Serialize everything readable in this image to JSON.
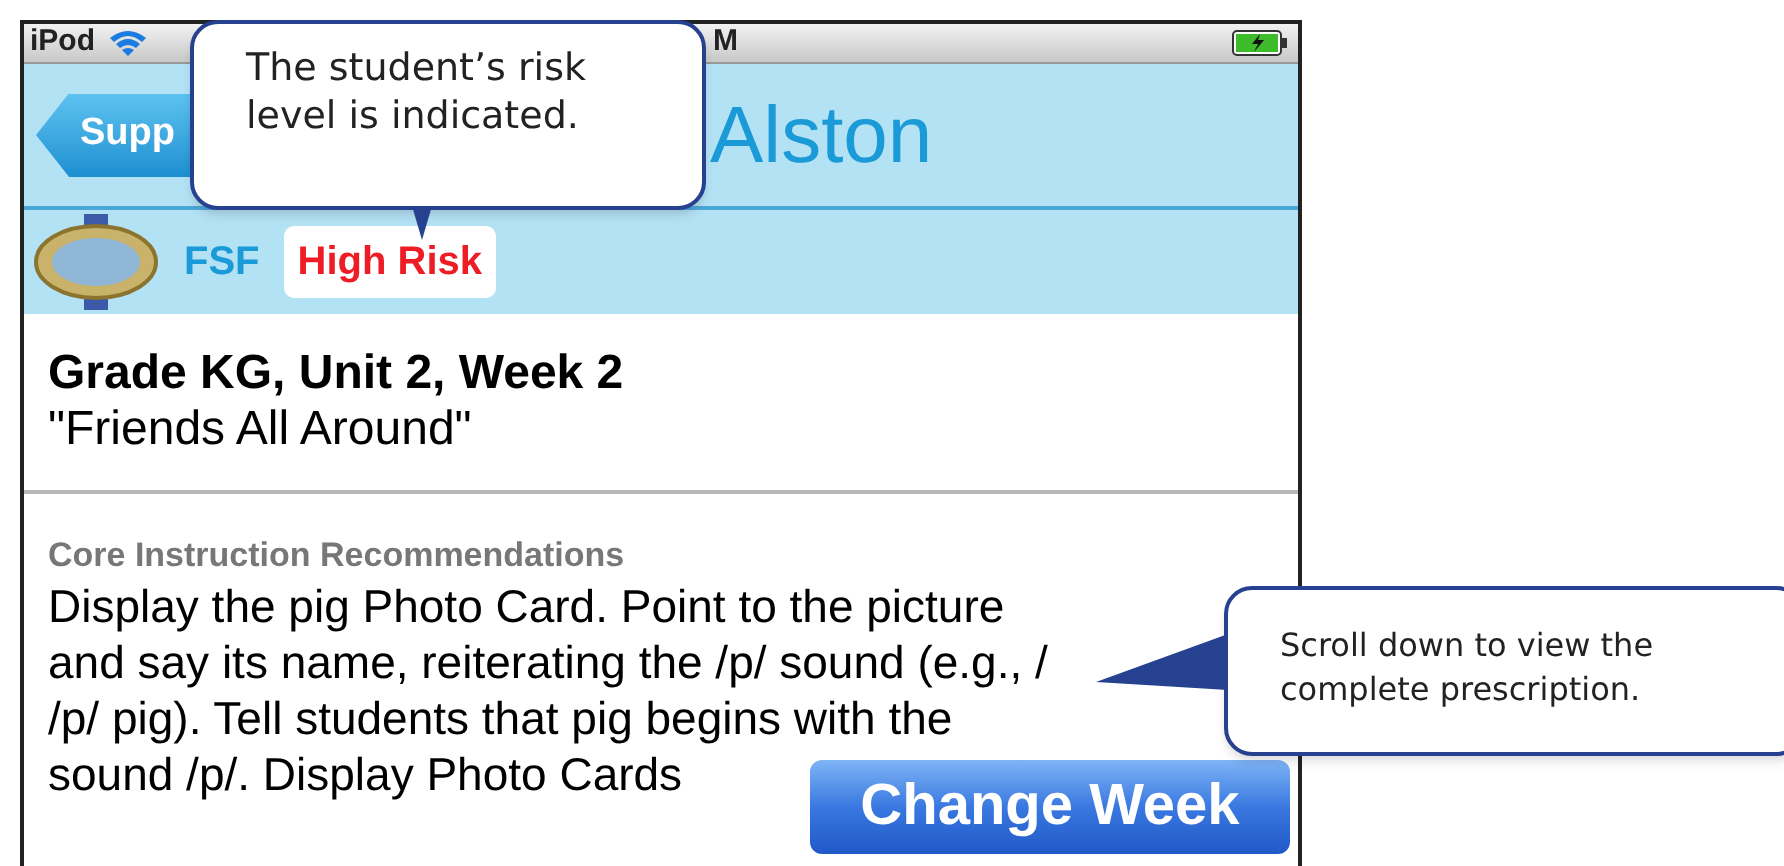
{
  "status_bar": {
    "carrier": "iPod",
    "time": "M"
  },
  "nav_bar": {
    "back_button": "Supp",
    "title": "Alston"
  },
  "assessment": {
    "measure": "FSF",
    "risk": "High Risk"
  },
  "lesson": {
    "heading": "Grade KG, Unit 2, Week 2",
    "subtitle": "\"Friends All Around\""
  },
  "section": {
    "label": "Core Instruction Recommendations",
    "lines": [
      "Display the pig Photo Card. Point to the picture",
      "and say its name, reiterating the /p/ sound (e.g., /",
      "/p/ pig). Tell students that pig begins with the",
      "sound /p/. Display Photo Cards"
    ]
  },
  "change_week_button": "Change Week",
  "callouts": [
    {
      "kind": "down",
      "text": "The student’s risk level is indicated."
    },
    {
      "kind": "left",
      "text": "Scroll down to view the complete prescription."
    }
  ]
}
